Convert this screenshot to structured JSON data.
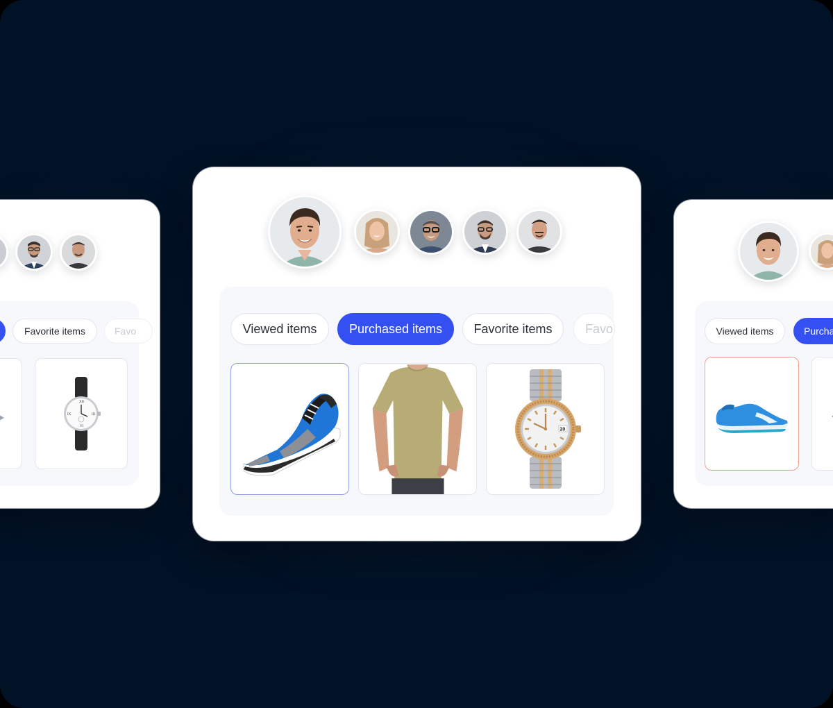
{
  "main_card": {
    "tabs": [
      {
        "label": "Viewed items",
        "state": "default"
      },
      {
        "label": "Purchased items",
        "state": "active"
      },
      {
        "label": "Favorite items",
        "state": "default"
      },
      {
        "label": "Favo",
        "state": "faded"
      }
    ],
    "products": [
      {
        "name": "sneaker-blue",
        "selected": true
      },
      {
        "name": "tshirt-olive",
        "selected": false
      },
      {
        "name": "watch-two-tone",
        "selected": false
      }
    ],
    "watch_date": "20"
  },
  "left_card": {
    "tabs": [
      {
        "label": "",
        "state": "active"
      },
      {
        "label": "Favorite items",
        "state": "default"
      },
      {
        "label": "Favo",
        "state": "faded"
      }
    ]
  },
  "right_card": {
    "tabs": [
      {
        "label": "Viewed items",
        "state": "default"
      },
      {
        "label": "Purcha",
        "state": "active"
      }
    ]
  },
  "colors": {
    "background": "#021226",
    "accent": "#3450f0",
    "selected_blue": "#8fa0e8",
    "selected_red": "#f0a08e"
  }
}
